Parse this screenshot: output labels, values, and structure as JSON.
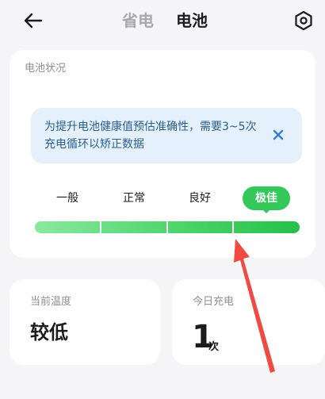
{
  "header": {
    "back_icon": "arrow-left-icon",
    "tabs": [
      {
        "label": "省电",
        "active": false
      },
      {
        "label": "电池",
        "active": true
      }
    ],
    "settings_icon": "gear-icon"
  },
  "battery_status": {
    "title": "电池状况",
    "notice": {
      "text": "为提升电池健康值预估准确性，需要3~5次充电循环以矫正数据",
      "close_icon": "close-icon"
    },
    "levels": [
      "一般",
      "正常",
      "良好",
      "极佳"
    ],
    "current_level": "极佳",
    "progress": 1.0
  },
  "stats": {
    "temperature": {
      "label": "当前温度",
      "value": "较低"
    },
    "charge_today": {
      "label": "今日充电",
      "value": "1",
      "unit": "次"
    }
  },
  "colors": {
    "accent_green": "#34c759",
    "notice_bg": "#e4f1fd",
    "notice_text": "#2c5e8f",
    "annotation_arrow": "#f04a43"
  }
}
